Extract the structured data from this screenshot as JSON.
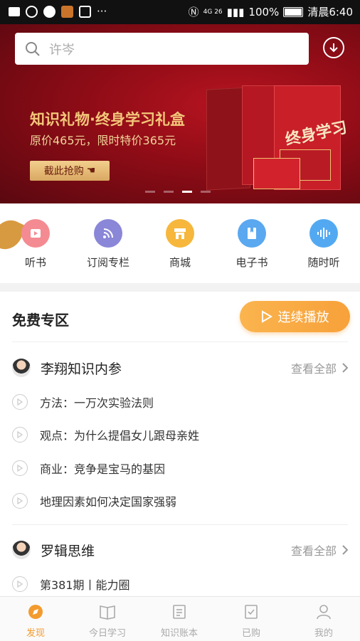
{
  "status_bar": {
    "battery": "100%",
    "time": "清晨6:40",
    "network": "4G 26"
  },
  "banner": {
    "search_placeholder": "许岑",
    "title": "知识礼物·终身学习礼盒",
    "subtitle": "原价465元，限时特价365元",
    "button": "截此抢购",
    "book_text": "终身学习"
  },
  "quick_nav": [
    {
      "label": "听书",
      "icon": "play-video-icon",
      "color": "#f48b92"
    },
    {
      "label": "订阅专栏",
      "icon": "rss-icon",
      "color": "#8a87d8"
    },
    {
      "label": "商城",
      "icon": "store-icon",
      "color": "#f6b73c"
    },
    {
      "label": "电子书",
      "icon": "ebook-icon",
      "color": "#5aa8f0"
    },
    {
      "label": "随时听",
      "icon": "audio-wave-icon",
      "color": "#53a9f1"
    }
  ],
  "free_zone": {
    "title": "免费专区",
    "play_all": "连续播放",
    "sections": [
      {
        "title": "李翔知识内参",
        "see_all": "查看全部",
        "items": [
          "方法：一万次实验法则",
          "观点：为什么提倡女儿跟母亲姓",
          "商业：竞争是宝马的基因",
          "地理因素如何决定国家强弱"
        ]
      },
      {
        "title": "罗辑思维",
        "see_all": "查看全部",
        "items": [
          "第381期丨能力圈"
        ]
      }
    ]
  },
  "tabs": [
    {
      "label": "发现",
      "icon": "compass-icon",
      "active": true
    },
    {
      "label": "今日学习",
      "icon": "book-open-icon",
      "active": false
    },
    {
      "label": "知识账本",
      "icon": "ledger-icon",
      "active": false
    },
    {
      "label": "已购",
      "icon": "purchased-icon",
      "active": false
    },
    {
      "label": "我的",
      "icon": "profile-icon",
      "active": false
    }
  ],
  "colors": {
    "accent": "#f39b2f",
    "banner": "#8e0c16"
  }
}
